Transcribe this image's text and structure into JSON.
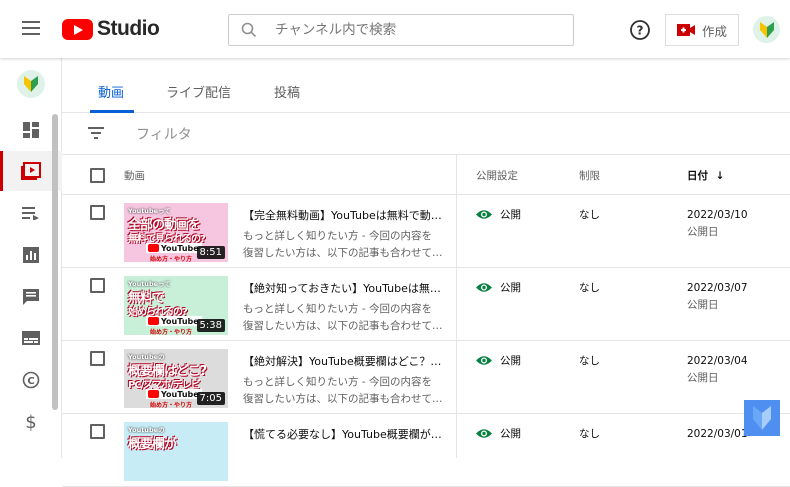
{
  "header": {
    "logo_text": "Studio",
    "search_placeholder": "チャンネル内で検索",
    "create_label": "作成"
  },
  "tabs": [
    {
      "label": "動画",
      "active": true
    },
    {
      "label": "ライブ配信",
      "active": false
    },
    {
      "label": "投稿",
      "active": false
    }
  ],
  "filter": {
    "placeholder": "フィルタ"
  },
  "columns": {
    "video": "動画",
    "visibility": "公開設定",
    "restrictions": "制限",
    "date": "日付"
  },
  "sidebar": {
    "items": [
      "dashboard-icon",
      "content-icon",
      "playlists-icon",
      "analytics-icon",
      "comments-icon",
      "subtitles-icon",
      "copyright-icon",
      "monetization-icon"
    ]
  },
  "rows": [
    {
      "thumb_top": "Youtubeって",
      "thumb_main": "全部の動画を",
      "thumb_main2": "無料で見られるの?",
      "thumb_badge": "YouTube",
      "thumb_sub": "始め方・やり方",
      "thumb_bg": "#f6c6e0",
      "duration": "8:51",
      "title": "【完全無料動画】YouTubeは無料で動…",
      "desc1": "もっと詳しく知りたい方 - 今回の内容を",
      "desc2": "復習したい方は、以下の記事も合わせて…",
      "visibility": "公開",
      "restriction": "なし",
      "date": "2022/03/10",
      "date_sub": "公開日"
    },
    {
      "thumb_top": "Youtubeって",
      "thumb_main": "無料で",
      "thumb_main2": "始められるの?",
      "thumb_badge": "YouTube",
      "thumb_sub": "始め方・やり方",
      "thumb_bg": "#c8f0d8",
      "duration": "5:38",
      "title": "【絶対知っておきたい】YouTubeは無…",
      "desc1": "もっと詳しく知りたい方 - 今回の内容を",
      "desc2": "復習したい方は、以下の記事も合わせて…",
      "visibility": "公開",
      "restriction": "なし",
      "date": "2022/03/07",
      "date_sub": "公開日"
    },
    {
      "thumb_top": "Youtubeの",
      "thumb_main": "概要欄はどこ?",
      "thumb_main2": "PC/スマホ/テレビ",
      "thumb_badge": "YouTube",
      "thumb_sub": "始め方・やり方",
      "thumb_bg": "#dcdcdc",
      "duration": "7:05",
      "title": "【絶対解決】YouTube概要欄はどこ？…",
      "desc1": "もっと詳しく知りたい方 - 今回の内容を",
      "desc2": "復習したい方は、以下の記事も合わせて…",
      "visibility": "公開",
      "restriction": "なし",
      "date": "2022/03/04",
      "date_sub": "公開日"
    },
    {
      "thumb_top": "Youtubeの",
      "thumb_main": "概要欄が",
      "thumb_main2": "",
      "thumb_badge": "",
      "thumb_sub": "",
      "thumb_bg": "#c8ecf6",
      "duration": "",
      "title": "【慌てる必要なし】YouTube概要欄が…",
      "desc1": "",
      "desc2": "",
      "visibility": "公開",
      "restriction": "なし",
      "date": "2022/03/01",
      "date_sub": ""
    }
  ],
  "colors": {
    "accent": "#065fd4",
    "brand_red": "#ff0000",
    "active_bar": "#cc0000",
    "public_green": "#0b8043"
  }
}
